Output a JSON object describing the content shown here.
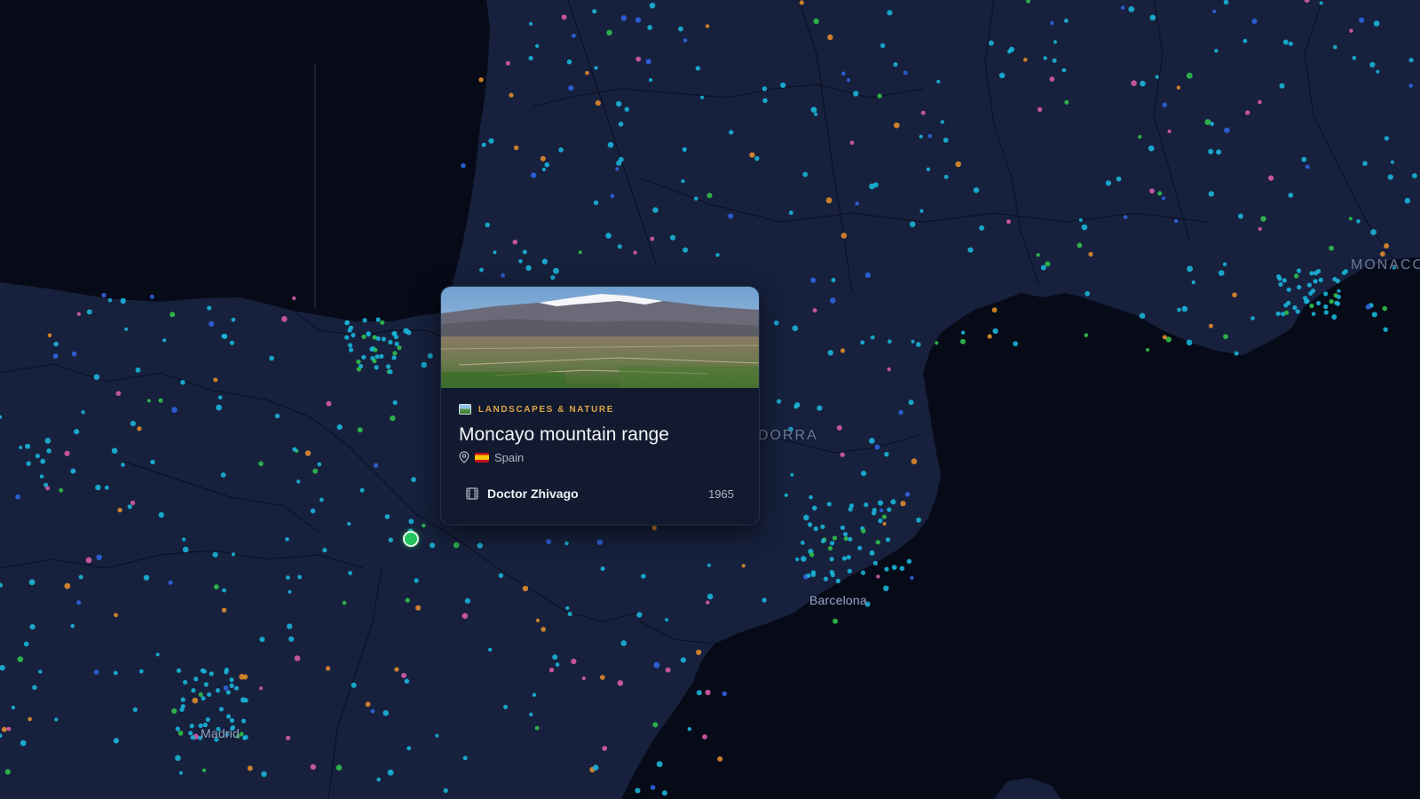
{
  "map": {
    "labels": {
      "andorra": "DORRA",
      "barcelona": "Barcelona",
      "madrid": "Madrid",
      "monaco": "MONACO"
    },
    "colors": {
      "land": "#17213d",
      "sea": "#070b18",
      "border": "#0c1224",
      "dot_cyan": "#1ab4d8",
      "dot_blue": "#2f63e0",
      "dot_green": "#2fbf4c",
      "dot_pink": "#d65aa7",
      "dot_orange": "#e08a2a",
      "selected_marker": "#22c55e"
    }
  },
  "popup": {
    "category_icon": "landscape-icon",
    "category": "LANDSCAPES & NATURE",
    "title": "Moncayo mountain range",
    "location_icon": "pin-icon",
    "flag": "spain-flag-icon",
    "country": "Spain",
    "film_icon": "film-icon",
    "film_title": "Doctor Zhivago",
    "film_year": "1965",
    "colors": {
      "card_bg": "#111a2e",
      "category": "#e0a64b"
    }
  }
}
